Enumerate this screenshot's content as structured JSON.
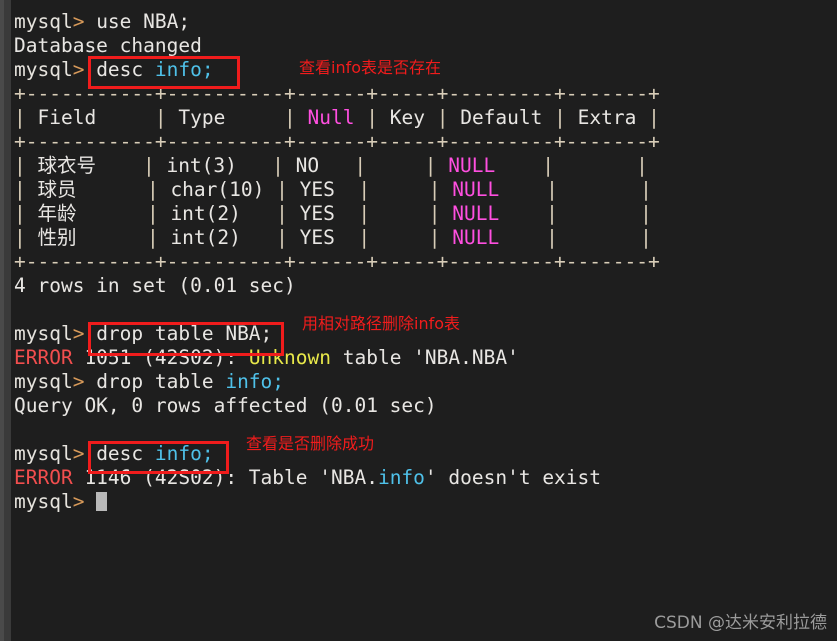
{
  "terminal": {
    "prompt": "mysql>",
    "lines": [
      {
        "id": "l1",
        "type": "cmd",
        "prompt": "mysql> ",
        "text": "use NBA;"
      },
      {
        "id": "l2",
        "type": "output",
        "text": "Database changed"
      },
      {
        "id": "l3",
        "type": "cmd",
        "prompt": "mysql> ",
        "text": "desc info;",
        "keyword": "desc ",
        "ident": "info;"
      },
      {
        "id": "l4",
        "type": "rule",
        "text": "+-----------+----------+------+-----+---------+-------+"
      },
      {
        "id": "l5",
        "type": "header",
        "text": "| Field     | Type     | Null | Key | Default | Extra |"
      },
      {
        "id": "l6",
        "type": "rule",
        "text": "+-----------+----------+------+-----+---------+-------+"
      },
      {
        "id": "l7",
        "type": "row",
        "text": "| 球衣号    | int(3)   | NO   |     | NULL    |       |"
      },
      {
        "id": "l8",
        "type": "row",
        "text": "| 球员      | char(10) | YES  |     | NULL    |       |"
      },
      {
        "id": "l9",
        "type": "row",
        "text": "| 年龄      | int(2)   | YES  |     | NULL    |       |"
      },
      {
        "id": "l10",
        "type": "row",
        "text": "| 性别      | int(2)   | YES  |     | NULL    |       |"
      },
      {
        "id": "l11",
        "type": "rule",
        "text": "+-----------+----------+------+-----+---------+-------+"
      },
      {
        "id": "l12",
        "type": "output",
        "text": "4 rows in set (0.01 sec)"
      },
      {
        "id": "l13",
        "type": "blank",
        "text": ""
      },
      {
        "id": "l14",
        "type": "cmd",
        "prompt": "mysql> ",
        "text": "drop table NBA;"
      },
      {
        "id": "l15",
        "type": "error",
        "text": "ERROR 1051 (42S02): Unknown table 'NBA.NBA'"
      },
      {
        "id": "l16",
        "type": "cmd",
        "prompt": "mysql> ",
        "text": "drop table info;"
      },
      {
        "id": "l17",
        "type": "output",
        "text": "Query OK, 0 rows affected (0.01 sec)"
      },
      {
        "id": "l18",
        "type": "blank",
        "text": ""
      },
      {
        "id": "l19",
        "type": "cmd",
        "prompt": "mysql> ",
        "text": "desc info;"
      },
      {
        "id": "l20",
        "type": "error",
        "text": "ERROR 1146 (42S02): Table 'NBA.info' doesn't exist"
      },
      {
        "id": "l21",
        "type": "cursor",
        "prompt": "mysql> ",
        "text": ""
      }
    ],
    "tokens": {
      "use_cmd": "use NBA;",
      "database_changed": "Database changed",
      "desc_keyword": "desc",
      "info_ident": "info;",
      "rows_in_set": "4 rows in set (0.01 sec)",
      "drop_nba": "drop table NBA;",
      "err_word": "ERROR",
      "err1051_code": " 1051 (42S02): ",
      "unknown_word": "Unknown",
      "err1051_tail": " table 'NBA.NBA'",
      "drop_kw": "drop table ",
      "info_cyan": "info;",
      "query_ok": "Query OK, 0 rows affected (0.01 sec)",
      "err1146_code": " 1146 (42S02): Table 'NBA.",
      "info_cyan2": "info",
      "err1146_tail": "' doesn't exist"
    }
  },
  "table": {
    "columns": [
      "Field",
      "Type",
      "Null",
      "Key",
      "Default",
      "Extra"
    ],
    "rows": [
      {
        "field": "球衣号",
        "type": "int(3)",
        "null": "NO",
        "key": "",
        "default": "NULL",
        "extra": ""
      },
      {
        "field": "球员",
        "type": "char(10)",
        "null": "YES",
        "key": "",
        "default": "NULL",
        "extra": ""
      },
      {
        "field": "年龄",
        "type": "int(2)",
        "null": "YES",
        "key": "",
        "default": "NULL",
        "extra": ""
      },
      {
        "field": "性别",
        "type": "int(2)",
        "null": "YES",
        "key": "",
        "default": "NULL",
        "extra": ""
      }
    ],
    "footer": "4 rows in set (0.01 sec)"
  },
  "annotations": [
    {
      "id": "a1",
      "text": "查看info表是否存在"
    },
    {
      "id": "a2",
      "text": "用相对路径删除info表"
    },
    {
      "id": "a3",
      "text": "查看是否删除成功"
    }
  ],
  "watermark": "CSDN @达米安利拉德",
  "colors": {
    "background": "#1e1e1e",
    "foreground": "#e8e6e3",
    "prompt": "#e6e3dd",
    "cyan": "#4fc1e9",
    "magenta": "#ff4fe0",
    "error_red": "#f24e4e",
    "yellow": "#e8e84a",
    "border": "#d8cdb8",
    "annotation_red": "#f01c1c",
    "watermark": "#9b9b9b"
  }
}
